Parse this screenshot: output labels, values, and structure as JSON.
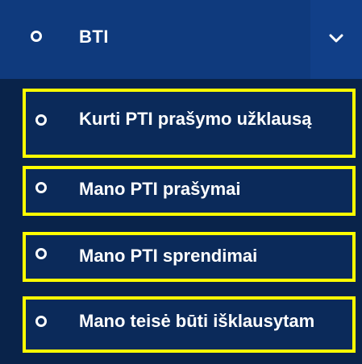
{
  "header": {
    "label": "BTI",
    "bullet_icon": "circle-outline-icon",
    "toggle_icon": "chevron-down-icon"
  },
  "submenu": {
    "items": [
      {
        "label": "Kurti PTI prašymo užklausą",
        "icon": "circle-outline-icon"
      },
      {
        "label": "Mano PTI prašymai",
        "icon": "circle-outline-icon"
      },
      {
        "label": "Mano PTI sprendimai",
        "icon": "circle-outline-icon"
      },
      {
        "label": "Mano teisė būti išklausytam",
        "icon": "circle-outline-icon"
      }
    ]
  },
  "colors": {
    "header_bg": "#0f3a7d",
    "submenu_bg": "#09234a",
    "item_bg": "#0b2a5a",
    "highlight_border": "#ffff00",
    "text": "#ffffff"
  }
}
